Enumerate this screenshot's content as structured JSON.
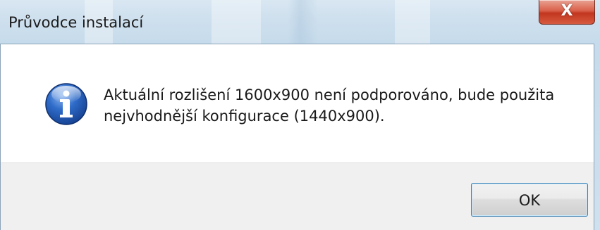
{
  "window": {
    "title": "Průvodce instalací",
    "close_label": "X"
  },
  "dialog": {
    "icon": "info-icon",
    "message_line1": "Aktuální rozlišení 1600x900 není podporováno, bude použita",
    "message_line2": "nejvhodnější konfigurace (1440x900).",
    "ok_label": "OK"
  },
  "colors": {
    "titlebar": "#cfe0ee",
    "close_button": "#c2361f",
    "info_icon": "#1f56b0",
    "footer": "#f0f0f0",
    "button_focus_border": "#3c7fb1"
  }
}
